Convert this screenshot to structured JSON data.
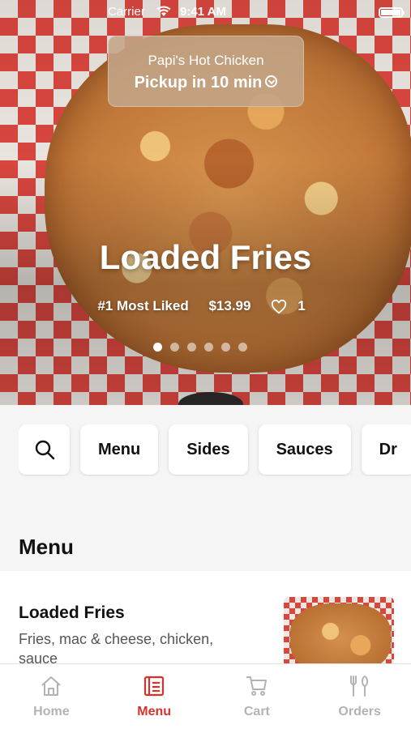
{
  "status_bar": {
    "carrier": "Carrier",
    "time": "9:41 AM"
  },
  "hero": {
    "store_name": "Papi's Hot Chicken",
    "pickup_label": "Pickup in 10 min",
    "title": "Loaded Fries",
    "rank": "#1 Most Liked",
    "price": "$13.99",
    "likes": "1",
    "carousel_pages": 6,
    "carousel_active_index": 0
  },
  "categories": [
    "Menu",
    "Sides",
    "Sauces",
    "Dr"
  ],
  "section_title": "Menu",
  "menu_item": {
    "name": "Loaded Fries",
    "description": "Fries, mac & cheese, chicken, sauce"
  },
  "tabs": [
    {
      "label": "Home",
      "icon": "home-icon",
      "active": false
    },
    {
      "label": "Menu",
      "icon": "menu-icon",
      "active": true
    },
    {
      "label": "Cart",
      "icon": "cart-icon",
      "active": false
    },
    {
      "label": "Orders",
      "icon": "orders-icon",
      "active": false
    }
  ],
  "colors": {
    "accent": "#d6322b",
    "inactive_tab": "#b3b3b3",
    "checker_red": "#d8463e"
  }
}
